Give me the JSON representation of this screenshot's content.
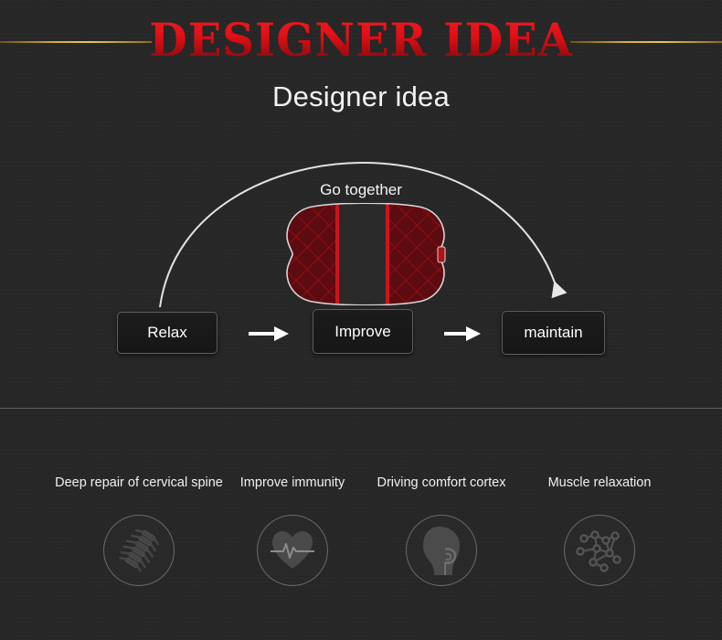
{
  "header": {
    "main_title": "DESIGNER IDEA",
    "subtitle": "Designer idea",
    "accent_gold": "#d4a83c",
    "accent_red": "#e10f16"
  },
  "flow": {
    "arc_label": "Go together",
    "steps": [
      {
        "label": "Relax"
      },
      {
        "label": "Improve"
      },
      {
        "label": "maintain"
      }
    ],
    "product": {
      "name": "car-headrest-pillow",
      "shape": "bone",
      "panel_color": "#6e0d12",
      "stripe_color": "#c8141c",
      "outline_color": "#d9d9d9"
    }
  },
  "features": [
    {
      "label": "Deep repair of cervical spine",
      "icon": "spine-icon"
    },
    {
      "label": "Improve immunity",
      "icon": "heart-ecg-icon"
    },
    {
      "label": "Driving comfort cortex",
      "icon": "head-profile-icon"
    },
    {
      "label": "Muscle relaxation",
      "icon": "molecule-icon"
    }
  ]
}
